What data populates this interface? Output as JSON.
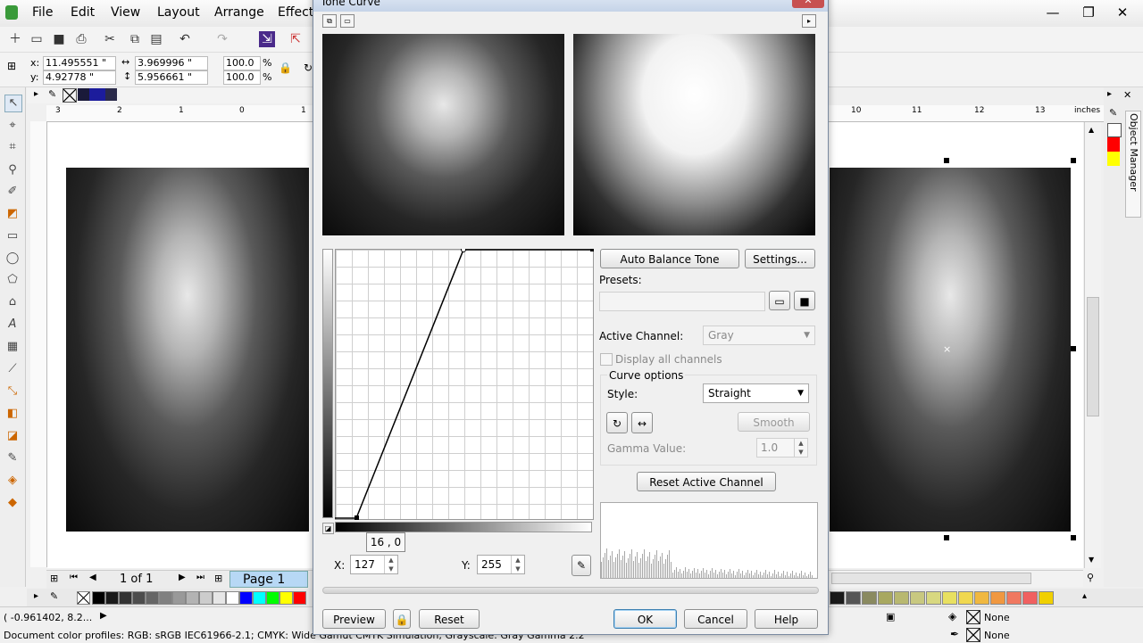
{
  "menu": [
    "File",
    "Edit",
    "View",
    "Layout",
    "Arrange",
    "Effects"
  ],
  "propbar": {
    "x": "11.495551 \"",
    "y": "4.92778 \"",
    "width": "3.969996 \"",
    "height": "5.956661 \"",
    "scale_x": "100.0",
    "scale_y": "100.0",
    "pct": "%"
  },
  "ruler_left": [
    "3",
    "2",
    "1",
    "0",
    "1"
  ],
  "ruler_right": [
    "10",
    "11",
    "12",
    "13",
    "inches"
  ],
  "page_nav": {
    "position": "1 of 1",
    "page_tab": "Page 1"
  },
  "docker": {
    "title": "Object Manager"
  },
  "status": {
    "coords": "( -0.961402, 8.2... ",
    "profiles": "Document color profiles: RGB: sRGB IEC61966-2.1; CMYK: Wide Gamut CMYK Simulation; Grayscale: Gray Gamma 2.2",
    "fill": "None",
    "outline": "None"
  },
  "palette_colors": [
    "#000000",
    "#1a1a1a",
    "#333333",
    "#4d4d4d",
    "#666666",
    "#808080",
    "#999999",
    "#b3b3b3",
    "#cccccc",
    "#e6e6e6",
    "#ffffff",
    "#0000ff",
    "#00ffff",
    "#00ff00",
    "#ffff00",
    "#ff0000"
  ],
  "palette_right": [
    "#1a1a1a",
    "#555555",
    "#8a8a60",
    "#a8a860",
    "#b8b870",
    "#c8c880",
    "#d8d880",
    "#e8e060",
    "#f0d850",
    "#f0b840",
    "#f09840",
    "#f07860",
    "#f06060",
    "#f0d000"
  ],
  "dialog": {
    "title": "Tone Curve",
    "buttons": {
      "auto_balance": "Auto Balance Tone",
      "settings": "Settings...",
      "reset_channel": "Reset Active Channel",
      "smooth": "Smooth",
      "preview": "Preview",
      "reset": "Reset",
      "ok": "OK",
      "cancel": "Cancel",
      "help": "Help"
    },
    "presets_label": "Presets:",
    "active_channel_label": "Active Channel:",
    "active_channel_value": "Gray",
    "display_all": "Display all channels",
    "curve_options": "Curve options",
    "style_label": "Style:",
    "style_value": "Straight",
    "gamma_label": "Gamma Value:",
    "gamma_value": "1.0",
    "tooltip": "16 , 0",
    "x_label": "X:",
    "x_value": "127",
    "y_label": "Y:",
    "y_value": "255"
  }
}
